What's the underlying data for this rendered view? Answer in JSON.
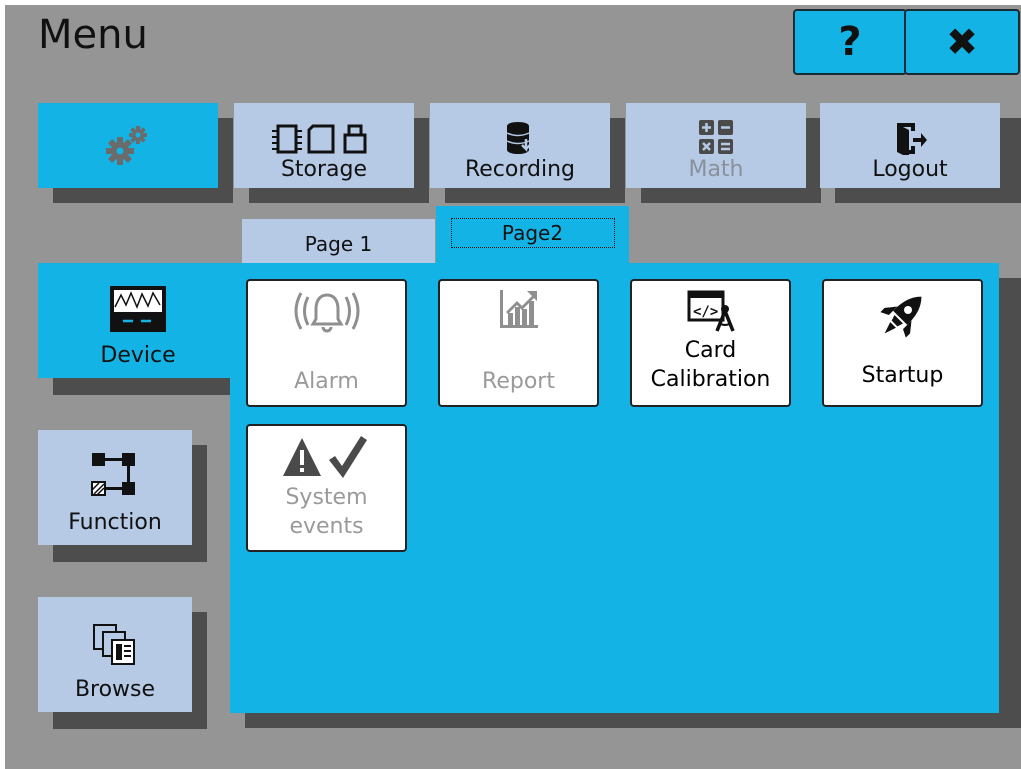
{
  "header": {
    "title": "Menu",
    "help_label": "?",
    "close_label": "✖"
  },
  "top_nav": {
    "settings_icon": "gears-icon",
    "items": [
      {
        "label": "Storage",
        "icon": "storage-icon",
        "enabled": true
      },
      {
        "label": "Recording",
        "icon": "database-icon",
        "enabled": true
      },
      {
        "label": "Math",
        "icon": "calculator-icon",
        "enabled": false
      },
      {
        "label": "Logout",
        "icon": "logout-icon",
        "enabled": true
      }
    ]
  },
  "side_nav": {
    "items": [
      {
        "label": "Device",
        "icon": "waveform-monitor-icon",
        "active": true
      },
      {
        "label": "Function",
        "icon": "function-blocks-icon",
        "active": false
      },
      {
        "label": "Browse",
        "icon": "browse-pages-icon",
        "active": false
      }
    ]
  },
  "tabs": [
    {
      "label": "Page 1",
      "active": false
    },
    {
      "label": "Page2",
      "active": true
    }
  ],
  "tiles": [
    {
      "label": "Alarm",
      "icon": "alarm-bell-icon",
      "enabled": false
    },
    {
      "label": "Report",
      "icon": "report-chart-icon",
      "enabled": false
    },
    {
      "label_line1": "Card",
      "label_line2": "Calibration",
      "icon": "code-compass-icon",
      "enabled": true
    },
    {
      "label": "Startup",
      "icon": "rocket-icon",
      "enabled": true
    },
    {
      "label_line1": "System",
      "label_line2": "events",
      "icon": "warning-check-icon",
      "enabled": false
    }
  ],
  "colors": {
    "background": "#969595",
    "accent": "#14b3e6",
    "nav_button": "#b6cae6",
    "shadow": "#4d4d4d"
  }
}
